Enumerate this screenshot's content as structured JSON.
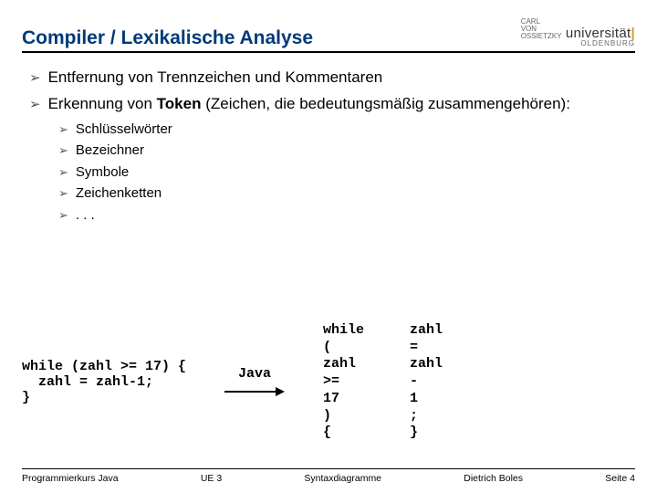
{
  "header": {
    "title": "Compiler / Lexikalische Analyse",
    "logo_lines": "CARL\nVON\nOSSIETZKY",
    "logo_uni": "universität",
    "logo_city": "OLDENBURG"
  },
  "bullets1": [
    "Entfernung von Trennzeichen und Kommentaren",
    "Erkennung von Token (Zeichen, die bedeutungsmäßig zusammengehören):"
  ],
  "bold_in_b1_1": "Token",
  "bullets2": [
    "Schlüsselwörter",
    "Bezeichner",
    "Symbole",
    "Zeichenketten",
    ". . ."
  ],
  "code_left": "while (zahl >= 17) {\n  zahl = zahl-1;\n}",
  "arrow_label": "Java",
  "tokens_col1": "while\n(\nzahl\n>=\n17\n)\n{",
  "tokens_col2": "zahl\n=\nzahl\n-\n1\n;\n}",
  "footer": {
    "course": "Programmierkurs Java",
    "unit": "UE 3",
    "topic": "Syntaxdiagramme",
    "author": "Dietrich Boles",
    "page": "Seite 4"
  }
}
